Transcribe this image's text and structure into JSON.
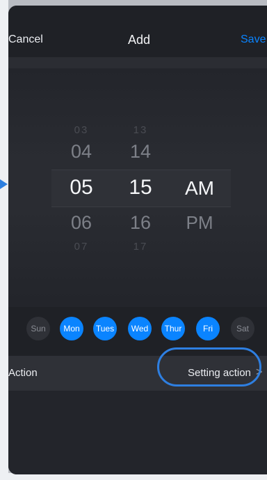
{
  "header": {
    "cancel_label": "Cancel",
    "title": "Add",
    "save_label": "Save"
  },
  "time_picker": {
    "hours": [
      "03",
      "04",
      "05",
      "06",
      "07"
    ],
    "minutes": [
      "13",
      "14",
      "15",
      "16",
      "17"
    ],
    "periods": [
      "AM",
      "PM"
    ],
    "selected": {
      "hour": "05",
      "minute": "15",
      "period": "AM"
    }
  },
  "days": [
    {
      "label": "Sun",
      "selected": false
    },
    {
      "label": "Mon",
      "selected": true
    },
    {
      "label": "Tues",
      "selected": true
    },
    {
      "label": "Wed",
      "selected": true
    },
    {
      "label": "Thur",
      "selected": true
    },
    {
      "label": "Fri",
      "selected": true
    },
    {
      "label": "Sat",
      "selected": false
    }
  ],
  "action": {
    "label": "Action",
    "value": "Setting action",
    "chevron": ">"
  },
  "colors": {
    "accent": "#0a84ff",
    "highlight_ring": "#2e7fe1",
    "sheet_bg": "#23252b"
  }
}
